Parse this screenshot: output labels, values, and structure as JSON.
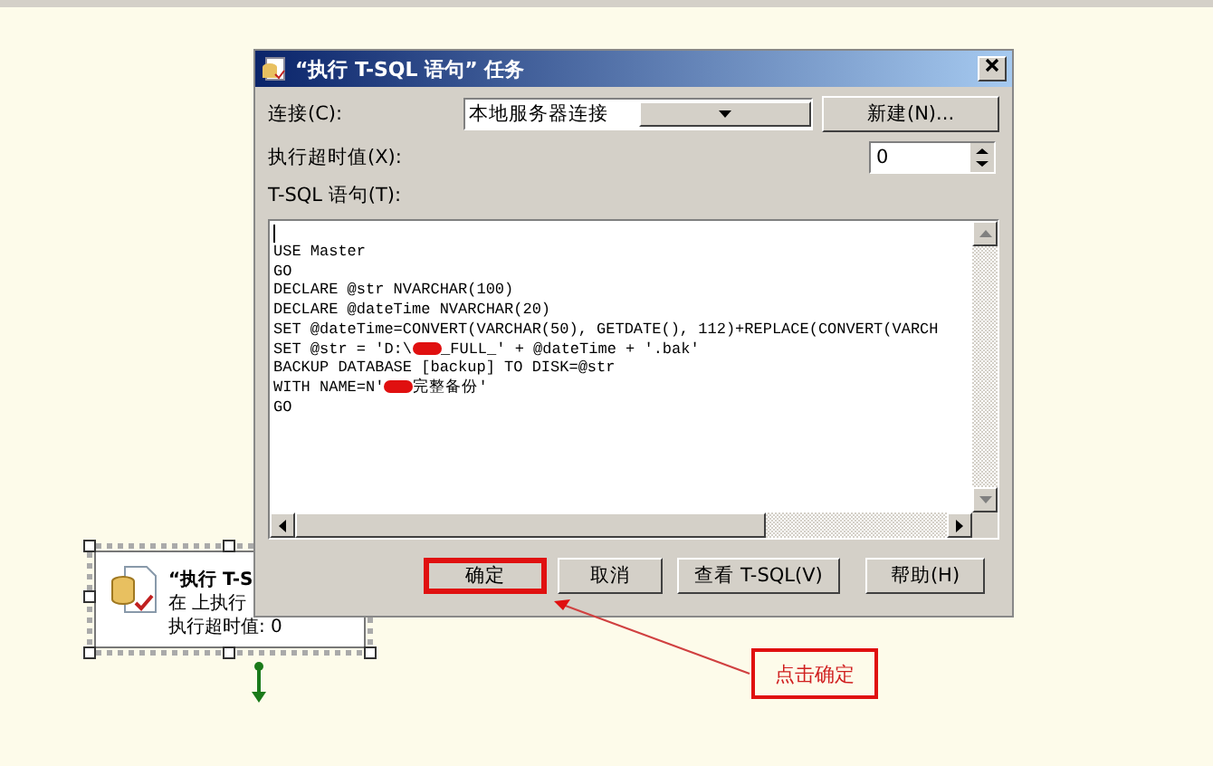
{
  "task_box": {
    "title": "“执行 T-S",
    "line_2": "在 上执行",
    "line_3": "执行超时值: 0"
  },
  "dialog": {
    "title": "“执行 T-SQL 语句” 任务",
    "connection": {
      "label": "连接(C):",
      "value": "本地服务器连接",
      "new_button": "新建(N)..."
    },
    "timeout": {
      "label": "执行超时值(X):",
      "value": "0"
    },
    "sql_label": "T-SQL 语句(T):",
    "sql_lines": [
      {
        "kind": "plain",
        "text": "USE Master"
      },
      {
        "kind": "plain",
        "text": "GO"
      },
      {
        "kind": "plain",
        "text": "DECLARE @str NVARCHAR(100)"
      },
      {
        "kind": "plain",
        "text": "DECLARE @dateTime NVARCHAR(20)"
      },
      {
        "kind": "plain",
        "text": "SET @dateTime=CONVERT(VARCHAR(50), GETDATE(), 112)+REPLACE(CONVERT(VARCH"
      },
      {
        "kind": "redacted",
        "before": "SET @str = 'D:\\",
        "after": "_FULL_' + @dateTime + '.bak'"
      },
      {
        "kind": "plain",
        "text": "BACKUP DATABASE [backup] TO DISK=@str"
      },
      {
        "kind": "redacted",
        "before": "WITH NAME=N'",
        "after": "完整备份'"
      },
      {
        "kind": "plain",
        "text": "GO"
      }
    ],
    "buttons": [
      {
        "label": "确定",
        "highlighted": true
      },
      {
        "label": "取消",
        "highlighted": false
      },
      {
        "label": "查看 T-SQL(V)",
        "highlighted": false
      },
      {
        "label": "帮助(H)",
        "highlighted": false
      }
    ]
  },
  "callout": {
    "text": "点击确定"
  }
}
